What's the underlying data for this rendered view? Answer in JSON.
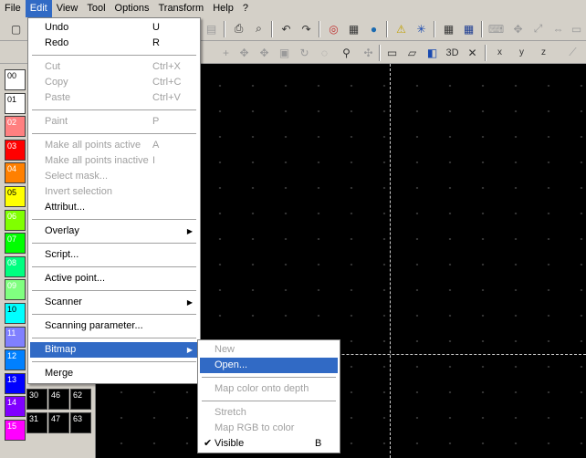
{
  "menubar": [
    "File",
    "Edit",
    "View",
    "Tool",
    "Options",
    "Transform",
    "Help",
    "?"
  ],
  "toolbar": {
    "buttons_row1": [
      "new-icon",
      "paste-icon",
      "print-icon",
      "print-preview-icon",
      "undo-icon",
      "redo-icon",
      "target-icon",
      "film-icon",
      "globe-icon",
      "warning-icon",
      "laser-icon",
      "grid-icon",
      "grid-blue-icon",
      "brush-icon",
      "move-icon",
      "resize-icon",
      "fit-icon",
      "cursor-icon"
    ],
    "row2_labels": {
      "three_d": "3D",
      "x_axis": "x",
      "y_axis": "y",
      "z_axis": "z"
    }
  },
  "palette": [
    {
      "label": "00",
      "color": "#ffffff",
      "text": "#000000"
    },
    {
      "label": "01",
      "color": "#ffffff",
      "text": "#000000"
    },
    {
      "label": "02",
      "color": "#ff8080",
      "text": "#ffffff"
    },
    {
      "label": "03",
      "color": "#ff0000",
      "text": "#ffffff"
    },
    {
      "label": "04",
      "color": "#ff8000",
      "text": "#ffffff"
    },
    {
      "label": "05",
      "color": "#ffff00",
      "text": "#000000"
    },
    {
      "label": "06",
      "color": "#80ff00",
      "text": "#ffffff"
    },
    {
      "label": "07",
      "color": "#00ff00",
      "text": "#ffffff"
    },
    {
      "label": "08",
      "color": "#00ff80",
      "text": "#ffffff"
    },
    {
      "label": "09",
      "color": "#80ff80",
      "text": "#ffffff"
    },
    {
      "label": "10",
      "color": "#00ffff",
      "text": "#000000"
    },
    {
      "label": "11",
      "color": "#8080ff",
      "text": "#ffffff"
    },
    {
      "label": "12",
      "color": "#0080ff",
      "text": "#ffffff"
    },
    {
      "label": "13",
      "color": "#0000ff",
      "text": "#ffffff"
    },
    {
      "label": "14",
      "color": "#8000ff",
      "text": "#ffffff"
    },
    {
      "label": "15",
      "color": "#ff00ff",
      "text": "#ffffff"
    }
  ],
  "palette_extra": [
    "30",
    "46",
    "62",
    "31",
    "47",
    "63"
  ],
  "edit_menu": {
    "undo": "Undo",
    "undo_sc": "U",
    "redo": "Redo",
    "redo_sc": "R",
    "cut": "Cut",
    "cut_sc": "Ctrl+X",
    "copy": "Copy",
    "copy_sc": "Ctrl+C",
    "paste": "Paste",
    "paste_sc": "Ctrl+V",
    "paint": "Paint",
    "paint_sc": "P",
    "make_active": "Make all points active",
    "make_active_sc": "A",
    "make_inactive": "Make all points inactive",
    "make_inactive_sc": "I",
    "select_mask": "Select mask...",
    "invert": "Invert selection",
    "attribut": "Attribut...",
    "overlay": "Overlay",
    "script": "Script...",
    "active_point": "Active point...",
    "scanner": "Scanner",
    "scanning_param": "Scanning parameter...",
    "bitmap": "Bitmap",
    "merge": "Merge"
  },
  "bitmap_menu": {
    "new": "New",
    "open": "Open...",
    "map_color": "Map color onto depth",
    "stretch": "Stretch",
    "map_rgb": "Map RGB to color",
    "visible": "Visible",
    "visible_sc": "B"
  },
  "colors": {
    "highlight": "#316ac5",
    "canvas": "#000000"
  }
}
